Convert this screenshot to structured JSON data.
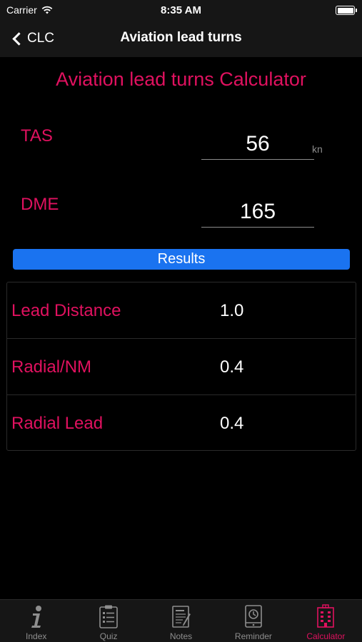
{
  "status_bar": {
    "carrier": "Carrier",
    "time": "8:35 AM"
  },
  "nav": {
    "back_label": "CLC",
    "title": "Aviation lead turns"
  },
  "calculator": {
    "title": "Aviation lead turns Calculator",
    "tas_label": "TAS",
    "tas_value": "56",
    "tas_unit": "kn",
    "dme_label": "DME",
    "dme_value": "165",
    "results_button": "Results"
  },
  "results": [
    {
      "label": "Lead Distance",
      "value": "1.0"
    },
    {
      "label": "Radial/NM",
      "value": "0.4"
    },
    {
      "label": "Radial Lead",
      "value": "0.4"
    }
  ],
  "tabs": [
    {
      "label": "Index",
      "icon": "info-icon",
      "active": false
    },
    {
      "label": "Quiz",
      "icon": "clipboard-list-icon",
      "active": false
    },
    {
      "label": "Notes",
      "icon": "notes-icon",
      "active": false
    },
    {
      "label": "Reminder",
      "icon": "clock-device-icon",
      "active": false
    },
    {
      "label": "Calculator",
      "icon": "calculator-building-icon",
      "active": true
    }
  ],
  "colors": {
    "accent": "#e0115f",
    "button": "#1a73f0",
    "background": "#000000",
    "bar": "#161616"
  }
}
